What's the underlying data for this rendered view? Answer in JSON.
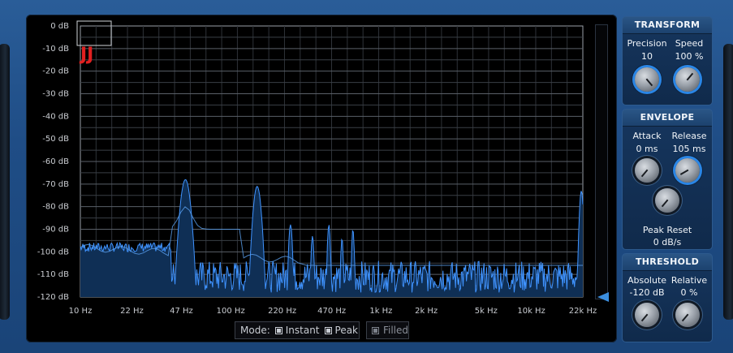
{
  "spectrum": {
    "db_labels": [
      "0 dB",
      "-10 dB",
      "-20 dB",
      "-30 dB",
      "-40 dB",
      "-50 dB",
      "-60 dB",
      "-70 dB",
      "-80 dB",
      "-90 dB",
      "-100 dB",
      "-110 dB",
      "-120 dB"
    ],
    "freq_labels": [
      "10 Hz",
      "22 Hz",
      "47 Hz",
      "100 Hz",
      "220 Hz",
      "470 Hz",
      "1k Hz",
      "2k Hz",
      "5k Hz",
      "10k Hz",
      "22k Hz"
    ],
    "line_color": "#3f93ff",
    "fill_color": "#0f2f55"
  },
  "logo": {
    "text": "JJ",
    "color": "#e02020"
  },
  "mode": {
    "label": "Mode:",
    "instant_label": "Instant",
    "instant_checked": true,
    "peak_label": "Peak",
    "peak_checked": true,
    "filled_label": "Filled",
    "filled_checked": true
  },
  "transform": {
    "title": "TRANSFORM",
    "precision_label": "Precision",
    "precision_value": "10",
    "speed_label": "Speed",
    "speed_value": "100 %"
  },
  "envelope": {
    "title": "ENVELOPE",
    "attack_label": "Attack",
    "attack_value": "0 ms",
    "release_label": "Release",
    "release_value": "105 ms",
    "peak_reset_label": "Peak Reset",
    "peak_reset_value": "0 dB/s"
  },
  "threshold": {
    "title": "THRESHOLD",
    "absolute_label": "Absolute",
    "absolute_value": "-120 dB",
    "relative_label": "Relative",
    "relative_value": "0 %"
  }
}
